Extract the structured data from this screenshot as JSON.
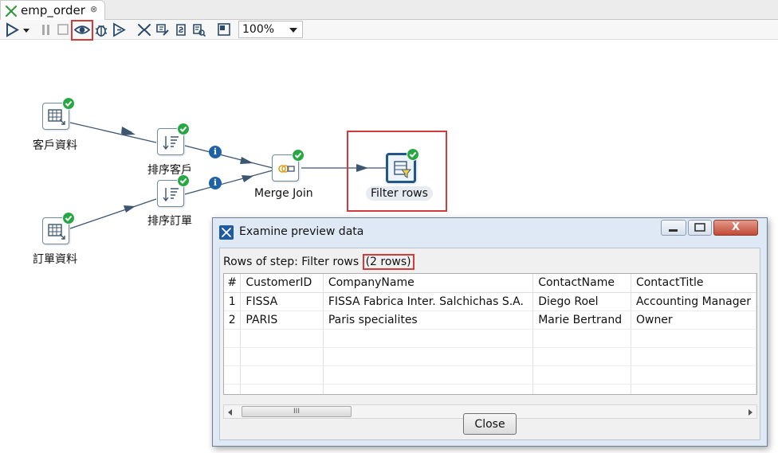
{
  "tab": {
    "title": "emp_order",
    "close_glyph": "⊗"
  },
  "toolbar": {
    "icons": [
      "run-icon",
      "run-dropdown-icon",
      "pause-icon",
      "stop-icon",
      "preview-icon",
      "debug-icon",
      "replay-icon",
      "verify-icon",
      "impact-icon",
      "sql-icon",
      "explore-db-icon",
      "show-results-icon"
    ],
    "zoom": "100%"
  },
  "steps": {
    "customer_data": "客戶資料",
    "sort_customer": "排序客戶",
    "sort_order": "排序訂單",
    "order_data": "訂單資料",
    "merge_join": "Merge Join",
    "filter_rows": "Filter rows"
  },
  "hop_info_glyph": "i",
  "dialog": {
    "title": "Examine preview data",
    "rows_label": "Rows of step: Filter rows ",
    "rows_count": "(2 rows)",
    "columns": [
      "#",
      "CustomerID",
      "CompanyName",
      "ContactName",
      "ContactTitle"
    ],
    "rows": [
      [
        "1",
        "FISSA",
        "FISSA Fabrica Inter. Salchichas S.A.",
        "Diego Roel",
        "Accounting Manager"
      ],
      [
        "2",
        "PARIS",
        "Paris specialites",
        "Marie Bertrand",
        "Owner"
      ]
    ],
    "scroll_thumb": "III",
    "close_label": "Close",
    "window_close_glyph": "X"
  },
  "colors": {
    "highlight": "#d33b3b",
    "ok": "#27a844",
    "info": "#1f62a8",
    "hop": "#3d5670"
  }
}
